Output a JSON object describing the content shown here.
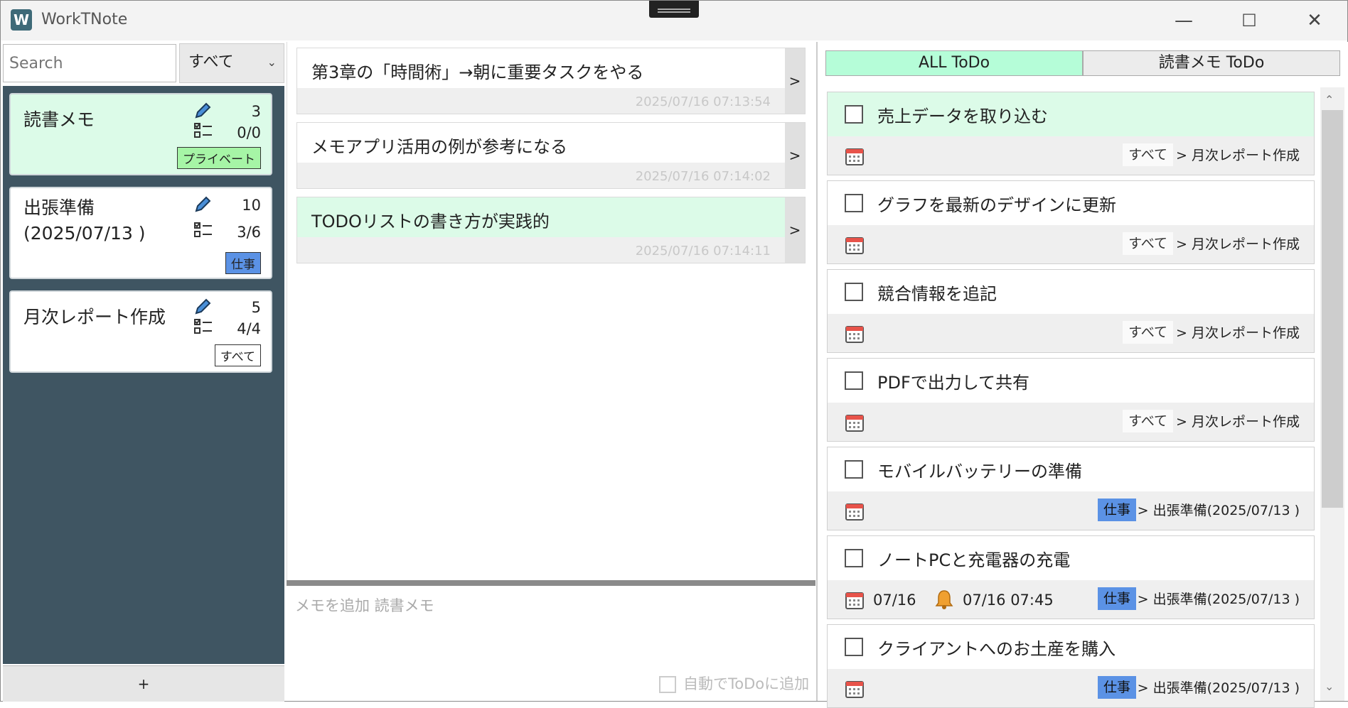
{
  "app": {
    "title": "WorkTNote",
    "icon_letter": "W"
  },
  "window_controls": {
    "minimize": "—",
    "maximize": "☐",
    "close": "✕"
  },
  "left": {
    "search_placeholder": "Search",
    "filter_value": "すべて",
    "notebooks": [
      {
        "title": "読書メモ",
        "memo_count": "3",
        "todo_count": "0/0",
        "tag": "プライベート",
        "tag_color": "#a6f5a6",
        "selected": true
      },
      {
        "title": "出張準備\n(2025/07/13 )",
        "memo_count": "10",
        "todo_count": "3/6",
        "tag": "仕事",
        "tag_color": "#5b92e5",
        "selected": false
      },
      {
        "title": "月次レポート作成",
        "memo_count": "5",
        "todo_count": "4/4",
        "tag": "すべて",
        "tag_color": "#ffffff",
        "selected": false
      }
    ],
    "add_label": "+"
  },
  "middle": {
    "memos": [
      {
        "text": "第3章の「時間術」→朝に重要タスクをやる",
        "date": "2025/07/16 07:13:54",
        "arrow": ">"
      },
      {
        "text": "メモアプリ活用の例が参考になる",
        "date": "2025/07/16 07:14:02",
        "arrow": ">"
      },
      {
        "text": "TODOリストの書き方が実践的",
        "date": "2025/07/16 07:14:11",
        "arrow": ">"
      }
    ],
    "input_placeholder": "メモを追加 読書メモ",
    "auto_todo_label": "自動でToDoに追加"
  },
  "right": {
    "tabs": {
      "all": "ALL ToDo",
      "notebook": "読書メモ ToDo"
    },
    "todos": [
      {
        "text": "売上データを取り込む",
        "tag": "すべて",
        "path": "> 月次レポート作成"
      },
      {
        "text": "グラフを最新のデザインに更新",
        "tag": "すべて",
        "path": "> 月次レポート作成"
      },
      {
        "text": "競合情報を追記",
        "tag": "すべて",
        "path": "> 月次レポート作成"
      },
      {
        "text": "PDFで出力して共有",
        "tag": "すべて",
        "path": "> 月次レポート作成"
      },
      {
        "text": "モバイルバッテリーの準備",
        "tag": "仕事",
        "path": "> 出張準備(2025/07/13 )"
      },
      {
        "text": "ノートPCと充電器の充電",
        "tag": "仕事",
        "path": "> 出張準備(2025/07/13 )",
        "date": "07/16",
        "alarm": "07/16 07:45"
      },
      {
        "text": "クライアントへのお土産を購入",
        "tag": "仕事",
        "path": "> 出張準備(2025/07/13 )"
      }
    ]
  },
  "colors": {
    "sidebar_bg": "#3f5562",
    "selected_bg": "#dcfbe8",
    "tab_active": "#b5fdd8",
    "work_tag": "#5b92e5",
    "private_tag": "#a6f5a6"
  }
}
